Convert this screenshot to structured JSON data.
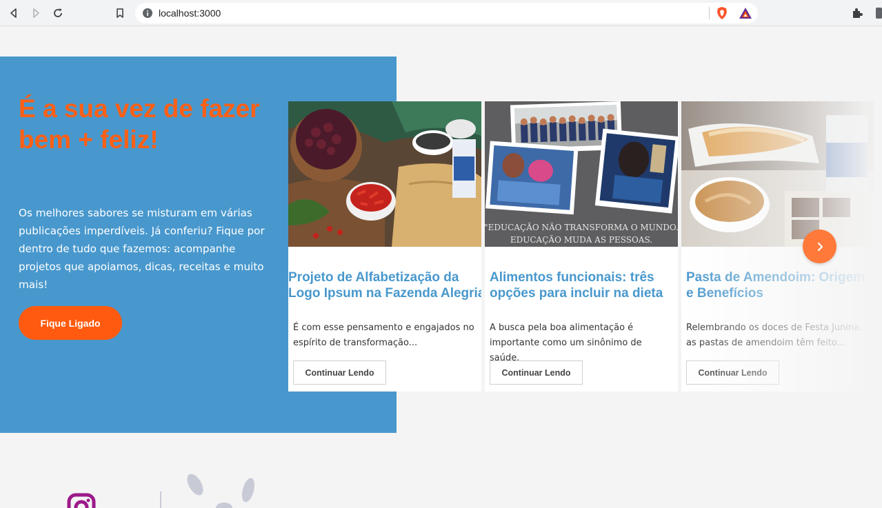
{
  "browser": {
    "url": "localhost:3000",
    "icons": [
      "back-icon",
      "forward-icon",
      "reload-icon",
      "bookmark-icon",
      "info-icon",
      "brave-shield-icon",
      "brave-rewards-icon",
      "extensions-icon"
    ]
  },
  "hero": {
    "title": "É a sua vez de fazer bem + feliz!",
    "text": "Os melhores sabores se misturam em várias publicações imperdíveis. Já conferiu? Fique por dentro de tudo que fazemos: acompanhe projetos que apoiamos, dicas, receitas e muito mais!",
    "cta_label": "Fique Ligado"
  },
  "cards": [
    {
      "title_line1": "Projeto de Alfabetização da",
      "title_line2": "Logo Ipsum na Fazenda Alegria",
      "text": "É com esse pensamento e engajados no espírito de transformação...",
      "button": "Continuar Lendo"
    },
    {
      "title_line1": "Alimentos funcionais: três",
      "title_line2": "opções para incluir na dieta",
      "text": "A busca pela boa alimentação é importante como um sinônimo de saúde.",
      "button": "Continuar Lendo",
      "image_caption_line1": "\"EDUCAÇÃO NÃO TRANSFORMA O MUNDO.",
      "image_caption_line2": "EDUCAÇÃO MUDA AS PESSOAS."
    },
    {
      "title_line1": "Pasta de Amendoim: Origem",
      "title_line2": "e Benefícios",
      "text": "Relembrando os doces de Festa Junina, as pastas de amendoim têm feito...",
      "button": "Continuar Lendo"
    }
  ],
  "colors": {
    "hero_bg": "#4898cd",
    "accent_orange": "#ff5a0f",
    "title_blue": "#4898cd",
    "page_bg": "#f4f4f4"
  }
}
